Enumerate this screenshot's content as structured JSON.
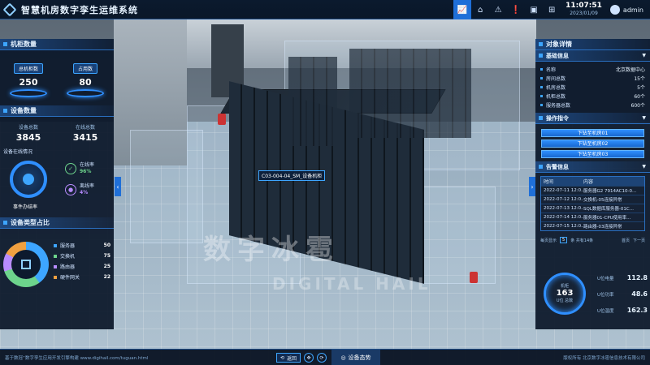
{
  "header": {
    "title": "智慧机房数字孪生运维系统",
    "time": "11:07:51",
    "date": "2023/01/09",
    "user": "admin",
    "icons": [
      "chart-icon",
      "home-icon",
      "alert-icon",
      "warning-icon",
      "image-icon",
      "apps-icon"
    ]
  },
  "left": {
    "cabinet_title": "机柜数量",
    "cabinet": [
      {
        "label": "总机柜数",
        "value": "250"
      },
      {
        "label": "占用数",
        "value": "80"
      }
    ],
    "device_title": "设备数量",
    "device": [
      {
        "label": "设备总数",
        "value": "3845"
      },
      {
        "label": "在线总数",
        "value": "3415"
      }
    ],
    "online_title": "设备在线情况",
    "online_rate_label": "在线率",
    "online_rate_value": "96",
    "offline_rate_label": "离线率",
    "offline_rate_value": "4",
    "event_label": "事件办结率",
    "types_title": "设备类型占比",
    "types": [
      {
        "name": "服务器",
        "value": "50",
        "color": "#3da5ff"
      },
      {
        "name": "交换机",
        "value": "75",
        "color": "#6dd48c"
      },
      {
        "name": "路由器",
        "value": "25",
        "color": "#b88cff"
      },
      {
        "name": "硬件网关",
        "value": "22",
        "color": "#f0a040"
      }
    ]
  },
  "right": {
    "panel_title": "对象详情",
    "basic_title": "基础信息",
    "basic": [
      {
        "k": "名称",
        "v": "北京数据中心"
      },
      {
        "k": "房间总数",
        "v": "15个"
      },
      {
        "k": "机房总数",
        "v": "5个"
      },
      {
        "k": "机柜总数",
        "v": "60个"
      },
      {
        "k": "服务器总数",
        "v": "600个"
      }
    ],
    "ops_title": "操作指令",
    "ops": [
      "下钻至机房01",
      "下钻至机房02",
      "下钻至机房03"
    ],
    "alarm_title": "告警信息",
    "alarm_headers": [
      "时间",
      "内容"
    ],
    "alarms": [
      {
        "time": "2022-07-11 12:0...",
        "content": "服务器G2 7914AC10-0..."
      },
      {
        "time": "2022-07-12 12:0...",
        "content": "交换机-05连接异常"
      },
      {
        "time": "2022-07-13 12:0...",
        "content": "SQL数据库服务器-01C..."
      },
      {
        "time": "2022-07-14 12:0...",
        "content": "服务器01-CPU使用率..."
      },
      {
        "time": "2022-07-15 12:0...",
        "content": "路由器-03连接异常"
      }
    ],
    "pager": {
      "prev": "每页显示",
      "size": "5",
      "total": "条 共有14条",
      "first": "首页",
      "next": "下一页"
    },
    "ring": {
      "a": "机柜",
      "b": "163",
      "c": "U位 总数"
    },
    "minis": [
      {
        "label": "U位电量",
        "value": "112.8"
      },
      {
        "label": "U位功率",
        "value": "48.6"
      },
      {
        "label": "U位温度",
        "value": "162.3"
      }
    ]
  },
  "scene": {
    "rack_label": "C03-004-04_SM_设备机柜",
    "watermark": "数字冰雹",
    "watermark_en": "DIGITAL HAIL"
  },
  "footer": {
    "left": "基于数冠“数字孪生应用开发引擎构建 www.digihail.com/tuguan.html",
    "right": "版权所有 北京数字冰雹信息技术有限公司",
    "back": "返回",
    "tab": "设备态势"
  }
}
